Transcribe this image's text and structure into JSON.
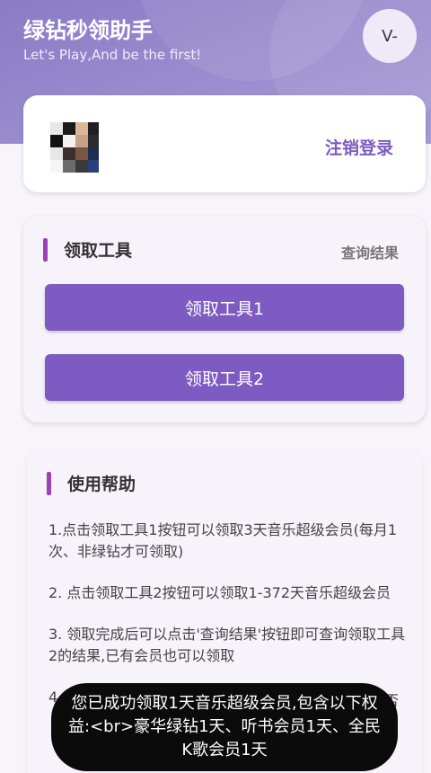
{
  "header": {
    "title": "绿钻秒领助手",
    "subtitle": "Let's Play,And be the first!",
    "version_badge": "V-"
  },
  "user_card": {
    "logout_label": "注销登录"
  },
  "tools": {
    "section_title": "领取工具",
    "query_link": "查询结果",
    "button_1": "领取工具1",
    "button_2": "领取工具2"
  },
  "help": {
    "section_title": "使用帮助",
    "items": [
      "1.点击领取工具1按钮可以领取3天音乐超级会员(每月1次、非绿钻才可领取)",
      "2. 点击领取工具2按钮可以领取1-372天音乐超级会员",
      "3. 领取完成后可以点击'查询结果'按钮即可查询领取工具2的结果,已有会员也可以领取"
    ],
    "item_4_prefix": "4",
    "item_4_peek": "否"
  },
  "toast": {
    "message": "您已成功领取1天音乐超级会员,包含以下权益:<br>豪华绿钻1天、听书会员1天、全民K歌会员1天"
  },
  "colors": {
    "header_gradient": "#9c8fd0",
    "accent_purple": "#7e5bc2",
    "section_marker": "#9c3fb8",
    "toast_bg": "#0b0b0b"
  }
}
